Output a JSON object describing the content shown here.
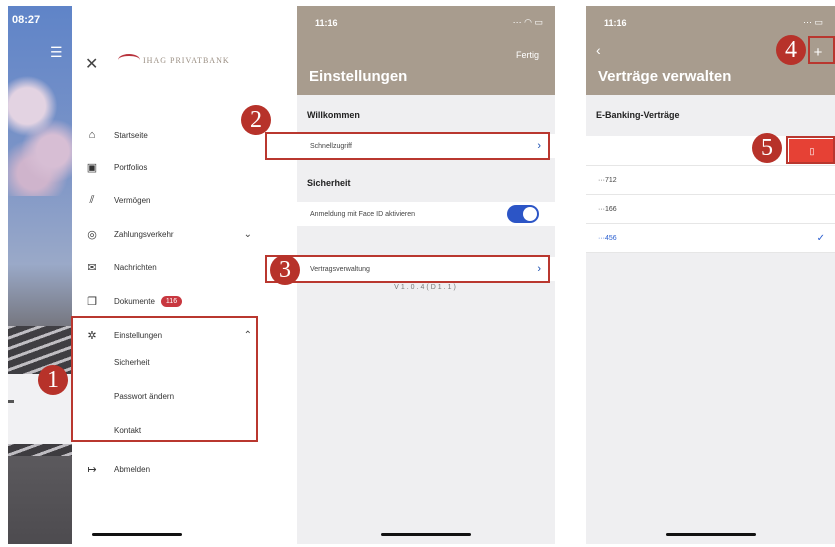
{
  "screen1": {
    "time": "08:27",
    "logo_mark": "IHAG",
    "logo_name": "PRIVATBANK",
    "menu": [
      {
        "label": "Startseite",
        "icon": "home-icon"
      },
      {
        "label": "Portfolios",
        "icon": "portfolio-icon"
      },
      {
        "label": "Vermögen",
        "icon": "chart-icon"
      },
      {
        "label": "Zahlungsverkehr",
        "icon": "payment-icon"
      },
      {
        "label": "Nachrichten",
        "icon": "mail-icon"
      },
      {
        "label": "Dokumente",
        "icon": "documents-icon",
        "badge": "116"
      },
      {
        "label": "Einstellungen",
        "icon": "settings-icon"
      }
    ],
    "submenu": [
      "Sicherheit",
      "Passwort ändern",
      "Kontakt"
    ],
    "logout": "Abmelden"
  },
  "screen2": {
    "time": "11:16",
    "done": "Fertig",
    "title": "Einstellungen",
    "section_welcome": "Willkommen",
    "quick_access": "Schnellzugriff",
    "section_security": "Sicherheit",
    "face_id": "Anmeldung mit Face ID aktivieren",
    "face_id_enabled": true,
    "contract_management": "Vertragsverwaltung",
    "version": "V1.0.4(D1.1)"
  },
  "screen3": {
    "time": "11:16",
    "title": "Verträge verwalten",
    "section": "E-Banking-Verträge",
    "contracts": [
      {
        "label": "···712",
        "selected": false
      },
      {
        "label": "···166",
        "selected": false
      },
      {
        "label": "···456",
        "selected": true
      }
    ]
  },
  "markers": [
    "1",
    "2",
    "3",
    "4",
    "5"
  ],
  "colors": {
    "accent": "#a89c8e",
    "marker": "#b7322a",
    "toggle": "#2c55c6",
    "delete": "#e64135"
  }
}
